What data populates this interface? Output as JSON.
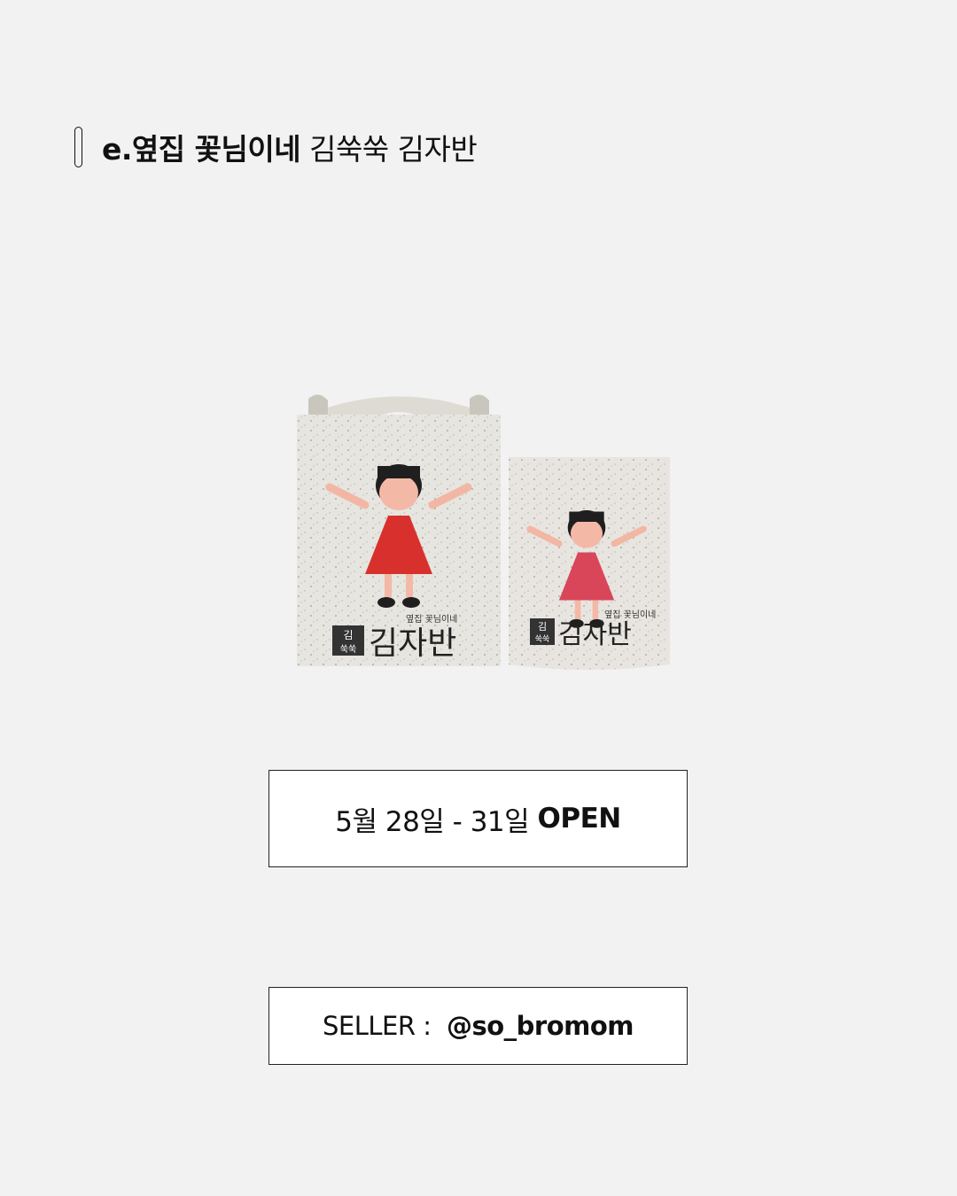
{
  "header": {
    "prefix": "e.옆집 꽃님이네",
    "suffix": "김쑥쑥 김자반"
  },
  "product": {
    "brand_small": "옆집 꽃님이네",
    "badge_top": "김",
    "badge_bottom": "쑥쑥",
    "name": "김자반",
    "colors": {
      "packaging": "#e7e5df",
      "dress": "#d8312d",
      "skin": "#f4b7a6",
      "hair": "#1c1c1c"
    }
  },
  "schedule": {
    "dates": "5월 28일 - 31일",
    "status": "OPEN"
  },
  "seller": {
    "label": "SELLER :",
    "handle": "@so_bromom"
  }
}
